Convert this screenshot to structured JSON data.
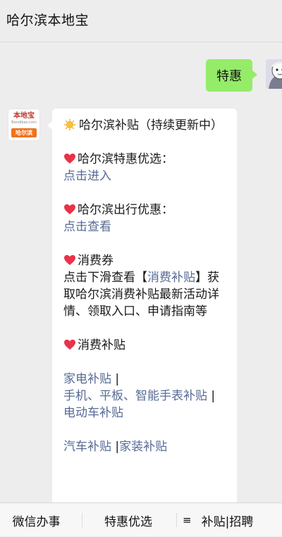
{
  "header": {
    "title": "哈尔滨本地宝"
  },
  "chat": {
    "sent_message": "特惠",
    "bot_avatar": {
      "logo_text": "本地宝",
      "logo_sub": "Bendibao.com",
      "city_tag": "哈尔滨"
    },
    "reply": {
      "intro": "哈尔滨补贴（持续更新中）",
      "section1_title": "哈尔滨特惠优选：",
      "section1_link": "点击进入",
      "section2_title": "哈尔滨出行优惠：",
      "section2_link": "点击查看",
      "section3_title": "消费券",
      "section3_text_before": "点击下滑查看【",
      "section3_link": "消费补贴",
      "section3_text_after": "】获取哈尔滨消费补贴最新活动详情、领取入口、申请指南等",
      "section4_title": "消费补贴",
      "subsidy_links_1": [
        "家电补贴",
        "手机、平板、智能手表补贴",
        "电动车补贴"
      ],
      "subsidy_links_2": [
        "汽车补贴",
        "家装补贴"
      ],
      "separator": "|"
    }
  },
  "bottom_menu": {
    "item1": "微信办事",
    "item2": "特惠优选",
    "item3_icon": "≡",
    "item3": "补贴|招聘"
  },
  "colors": {
    "link": "#576b95",
    "sent_bubble": "#95ec69",
    "heart": "#e8334a"
  },
  "icons": {
    "sun": "sun-icon",
    "heart": "heart-icon",
    "menu": "menu-icon"
  }
}
